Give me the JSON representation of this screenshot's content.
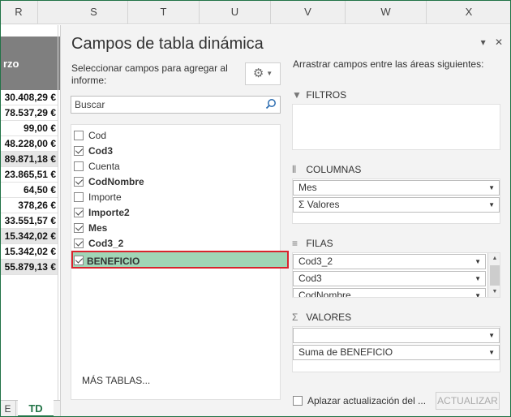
{
  "sheet": {
    "column_headers": [
      "R",
      "S",
      "T",
      "U",
      "V",
      "W",
      "X"
    ],
    "header_cell": "rzo",
    "cells": [
      "30.408,29 €",
      "78.537,29 €",
      "99,00 €",
      "48.228,00 €",
      "89.871,18 €",
      "23.865,51 €",
      "64,50 €",
      "378,26 €",
      "33.551,57 €",
      "15.342,02 €",
      "15.342,02 €",
      "55.879,13 €"
    ],
    "tabs": [
      "E",
      "TD"
    ]
  },
  "pane": {
    "title": "Campos de tabla dinámica",
    "controls": {
      "dropdown": "▾",
      "close": "✕"
    },
    "choose_label": "Seleccionar campos para agregar al informe:",
    "gear_icon": "⚙",
    "search_placeholder": "Buscar",
    "fields": [
      {
        "label": "Cod",
        "checked": false,
        "bold": false
      },
      {
        "label": "Cod3",
        "checked": true,
        "bold": true
      },
      {
        "label": "Cuenta",
        "checked": false,
        "bold": false
      },
      {
        "label": "CodNombre",
        "checked": true,
        "bold": true
      },
      {
        "label": "Importe",
        "checked": false,
        "bold": false
      },
      {
        "label": "Importe2",
        "checked": true,
        "bold": true
      },
      {
        "label": "Mes",
        "checked": true,
        "bold": true
      },
      {
        "label": "Cod3_2",
        "checked": true,
        "bold": true
      },
      {
        "label": "BENEFICIO",
        "checked": true,
        "bold": true,
        "selected": true
      }
    ],
    "more_tables": "MÁS TABLAS...",
    "areas_label": "Arrastrar campos entre las áreas siguientes:",
    "areas": {
      "filters": {
        "label": "FILTROS",
        "icon": "filter-icon",
        "items": []
      },
      "columns": {
        "label": "COLUMNAS",
        "icon": "columns-icon",
        "items": [
          "Mes",
          "Σ Valores"
        ]
      },
      "rows": {
        "label": "FILAS",
        "icon": "rows-icon",
        "items": [
          "Cod3_2",
          "Cod3",
          "CodNombre"
        ]
      },
      "values": {
        "label": "VALORES",
        "icon": "sigma-icon",
        "items": [
          "",
          "Suma de BENEFICIO"
        ]
      }
    },
    "defer_label": "Aplazar actualización del ...",
    "update_button": "ACTUALIZAR"
  }
}
